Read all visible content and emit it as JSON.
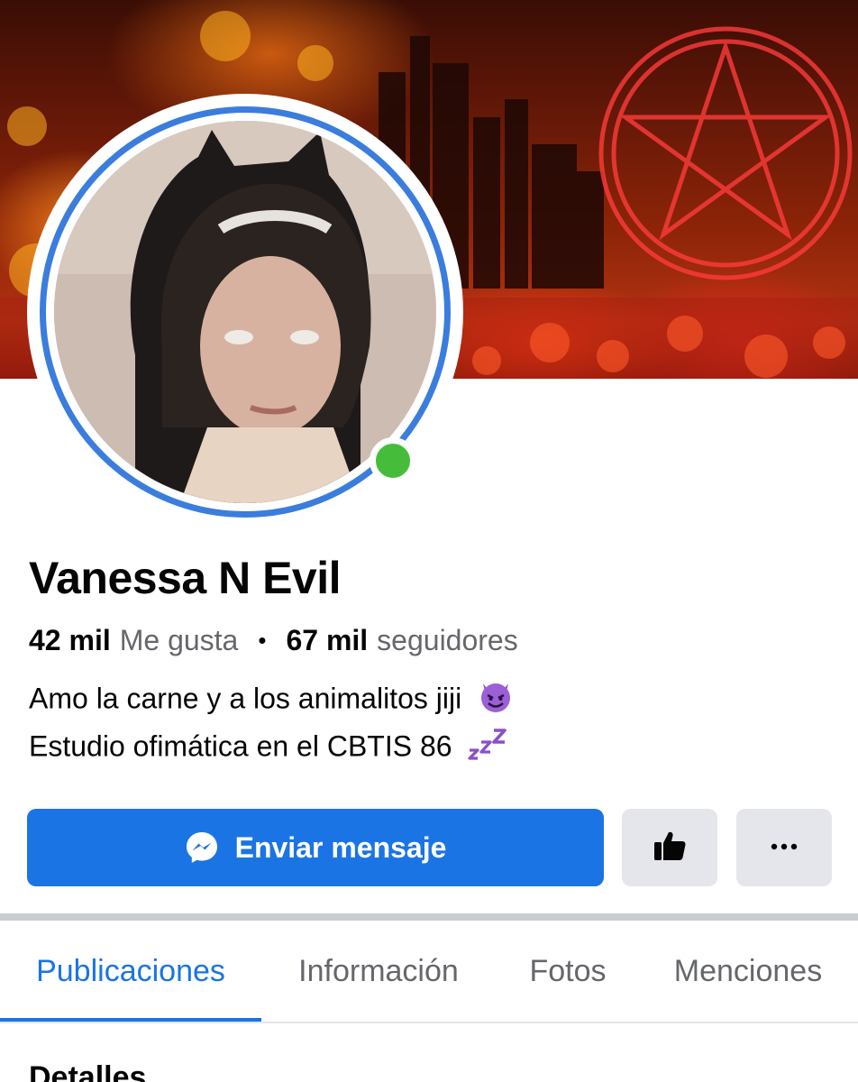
{
  "profile": {
    "name": "Vanessa N Evil",
    "likes_count": "42 mil",
    "likes_label": "Me gusta",
    "separator": "•",
    "followers_count": "67 mil",
    "followers_label": "seguidores",
    "bio_line1": "Amo la carne y a los animalitos jiji",
    "bio_line2": "Estudio ofimática en el CBTIS 86",
    "online": true
  },
  "actions": {
    "message_label": "Enviar mensaje"
  },
  "tabs": [
    {
      "label": "Publicaciones",
      "active": true
    },
    {
      "label": "Información",
      "active": false
    },
    {
      "label": "Fotos",
      "active": false
    },
    {
      "label": "Menciones",
      "active": false
    }
  ],
  "section": {
    "title": "Detalles"
  },
  "colors": {
    "accent": "#1b74e4",
    "avatar_ring": "#3b7ddd",
    "online_dot": "#45bd3a",
    "secondary_button": "#e4e6eb"
  },
  "icons": {
    "message": "messenger-icon",
    "like": "thumbs-up-icon",
    "more": "more-horizontal-icon",
    "bio_emoji_1": "smiling-devil-emoji",
    "bio_emoji_2": "zzz-emoji"
  }
}
